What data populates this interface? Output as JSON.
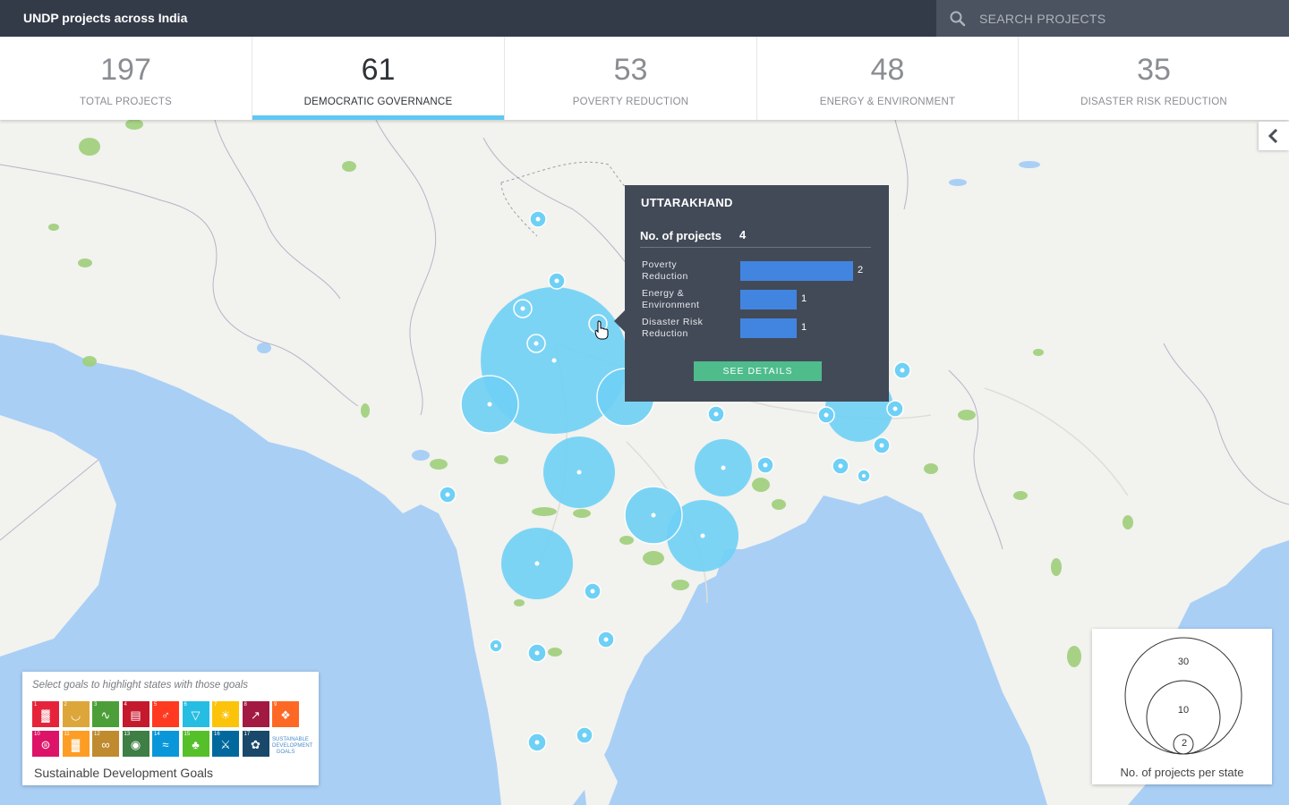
{
  "app": {
    "title": "UNDP projects across India"
  },
  "search": {
    "placeholder": "SEARCH PROJECTS",
    "value": ""
  },
  "stats": [
    {
      "value": "197",
      "label": "TOTAL PROJECTS",
      "active": false
    },
    {
      "value": "61",
      "label": "DEMOCRATIC GOVERNANCE",
      "active": true
    },
    {
      "value": "53",
      "label": "POVERTY REDUCTION",
      "active": false
    },
    {
      "value": "48",
      "label": "ENERGY & ENVIRONMENT",
      "active": false
    },
    {
      "value": "35",
      "label": "DISASTER RISK REDUCTION",
      "active": false
    }
  ],
  "tooltip": {
    "state": "UTTARAKHAND",
    "count_label": "No. of projects",
    "count_value": "4",
    "rows": [
      {
        "label": "Poverty Reduction",
        "value": 2
      },
      {
        "label": "Energy & Environment",
        "value": 1
      },
      {
        "label": "Disaster Risk Reduction",
        "value": 1
      }
    ],
    "button_label": "SEE DETAILS"
  },
  "sdg": {
    "hint": "Select goals to highlight states with those goals",
    "caption": "Sustainable Development Goals",
    "goals": [
      {
        "num": "1",
        "color": "#e5243b",
        "icon": "people-icon"
      },
      {
        "num": "2",
        "color": "#dda63a",
        "icon": "bowl-icon"
      },
      {
        "num": "3",
        "color": "#4c9f38",
        "icon": "heartbeat-icon"
      },
      {
        "num": "4",
        "color": "#c5192d",
        "icon": "book-icon"
      },
      {
        "num": "5",
        "color": "#ff3a21",
        "icon": "gender-icon"
      },
      {
        "num": "6",
        "color": "#26bde2",
        "icon": "water-icon"
      },
      {
        "num": "7",
        "color": "#fcc30b",
        "icon": "sun-icon"
      },
      {
        "num": "8",
        "color": "#a21942",
        "icon": "growth-chart-icon"
      },
      {
        "num": "9",
        "color": "#fd6925",
        "icon": "cubes-icon"
      },
      {
        "num": "10",
        "color": "#dd1367",
        "icon": "equal-icon"
      },
      {
        "num": "11",
        "color": "#fd9d24",
        "icon": "city-icon"
      },
      {
        "num": "12",
        "color": "#bf8b2e",
        "icon": "infinity-icon"
      },
      {
        "num": "13",
        "color": "#3f7e44",
        "icon": "eye-icon"
      },
      {
        "num": "14",
        "color": "#0a97d9",
        "icon": "fish-icon"
      },
      {
        "num": "15",
        "color": "#56c02b",
        "icon": "tree-icon"
      },
      {
        "num": "16",
        "color": "#00689d",
        "icon": "dove-icon"
      },
      {
        "num": "17",
        "color": "#19486a",
        "icon": "flower-icon"
      }
    ],
    "logo_text": "SUSTAINABLE DEVELOPMENT GOALS"
  },
  "legend": {
    "caption": "No. of projects per state",
    "values": [
      "30",
      "10",
      "2"
    ]
  },
  "colors": {
    "accent": "#5fc8f3",
    "bubble": "#6fd0f5",
    "topbar": "#343b48",
    "tooltip_bg": "#424a57",
    "bar": "#4285e0",
    "button": "#4fbc8c"
  }
}
